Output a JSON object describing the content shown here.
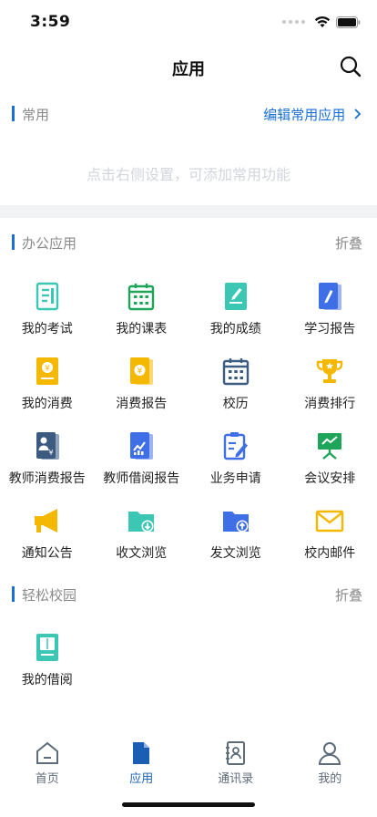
{
  "status": {
    "time": "3:59"
  },
  "nav": {
    "title": "应用"
  },
  "common": {
    "title": "常用",
    "edit_label": "编辑常用应用",
    "empty_hint": "点击右侧设置，可添加常用功能"
  },
  "office": {
    "title": "办公应用",
    "collapse_label": "折叠",
    "apps": [
      {
        "label": "我的考试",
        "icon": "exam-icon"
      },
      {
        "label": "我的课表",
        "icon": "calendar-icon"
      },
      {
        "label": "我的成绩",
        "icon": "grades-icon"
      },
      {
        "label": "学习报告",
        "icon": "study-report-icon"
      },
      {
        "label": "我的消费",
        "icon": "consumption-icon"
      },
      {
        "label": "消费报告",
        "icon": "consumption-report-icon"
      },
      {
        "label": "校历",
        "icon": "school-calendar-icon"
      },
      {
        "label": "消费排行",
        "icon": "trophy-icon"
      },
      {
        "label": "教师消费报告",
        "icon": "teacher-consumption-icon"
      },
      {
        "label": "教师借阅报告",
        "icon": "teacher-borrow-report-icon"
      },
      {
        "label": "业务申请",
        "icon": "business-apply-icon"
      },
      {
        "label": "会议安排",
        "icon": "meeting-icon"
      },
      {
        "label": "通知公告",
        "icon": "megaphone-icon"
      },
      {
        "label": "收文浏览",
        "icon": "folder-download-icon"
      },
      {
        "label": "发文浏览",
        "icon": "folder-upload-icon"
      },
      {
        "label": "校内邮件",
        "icon": "mail-icon"
      }
    ]
  },
  "campus": {
    "title": "轻松校园",
    "collapse_label": "折叠",
    "apps": [
      {
        "label": "我的借阅",
        "icon": "book-icon"
      }
    ]
  },
  "tabs": [
    {
      "label": "首页",
      "icon": "home-icon",
      "active": false
    },
    {
      "label": "应用",
      "icon": "document-icon",
      "active": true
    },
    {
      "label": "通讯录",
      "icon": "contacts-icon",
      "active": false
    },
    {
      "label": "我的",
      "icon": "profile-icon",
      "active": false
    }
  ],
  "colors": {
    "accent": "#1a6fd6",
    "teal": "#3cc7b4",
    "green": "#1ea55a",
    "yellow": "#f5b800",
    "navy": "#3d5a80",
    "blue": "#3f6fe6"
  }
}
